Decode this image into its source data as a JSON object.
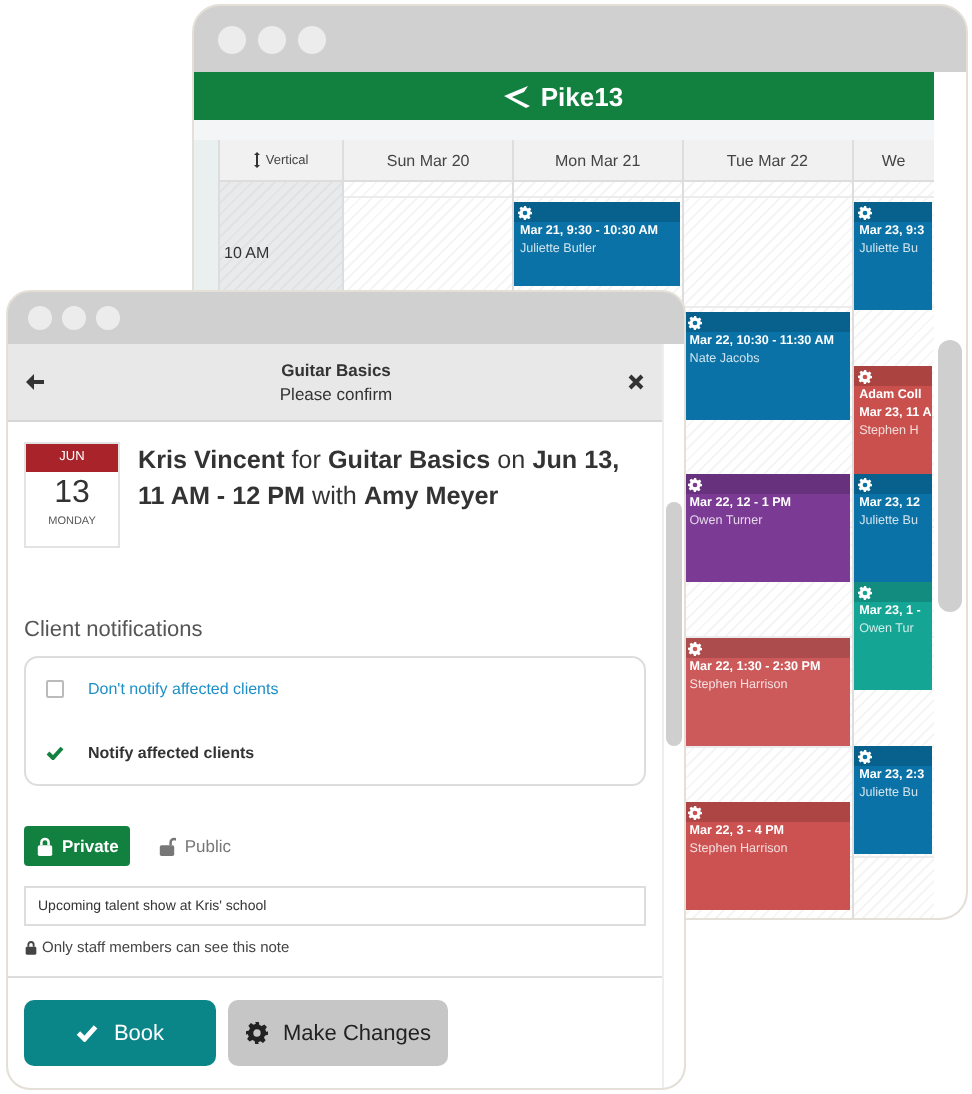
{
  "calendar_window": {
    "brand": "Pike13",
    "view_toggle": "Vertical",
    "time_labels": [
      "10 AM"
    ],
    "columns": [
      {
        "label": "Sun Mar 20"
      },
      {
        "label": "Mon Mar 21",
        "events": [
          {
            "time": "Mar 21, 9:30 - 10:30 AM",
            "client": "Juliette Butler",
            "color": "#0a72a6"
          }
        ]
      },
      {
        "label": "Tue Mar 22",
        "events": [
          {
            "time": "Mar 22, 10:30 - 11:30 AM",
            "client": "Nate Jacobs",
            "color": "#0a72a6"
          },
          {
            "time": "Mar 22, 12 - 1 PM",
            "client": "Owen Turner",
            "color": "#7b3a93"
          },
          {
            "time": "Mar 22, 1:30 - 2:30 PM",
            "client": "Stephen Harrison",
            "color": "#cc5a5a"
          },
          {
            "time": "Mar 22, 3 - 4 PM",
            "client": "Stephen Harrison",
            "color": "#cc5252"
          }
        ]
      },
      {
        "label": "We",
        "events": [
          {
            "time": "Mar 23, 9:3",
            "client": "Juliette Bu",
            "color": "#0a72a6"
          },
          {
            "title": "Adam Coll",
            "time": "Mar 23, 11 A",
            "client": "Stephen H",
            "color": "#c9504c"
          },
          {
            "time": "Mar 23, 12",
            "client": "Juliette Bu",
            "color": "#0a72a6"
          },
          {
            "time": "Mar 23, 1 -",
            "client": "Owen Tur",
            "color": "#14a594"
          },
          {
            "time": "Mar 23, 2:3",
            "client": "Juliette Bu",
            "color": "#0a72a6"
          }
        ]
      }
    ]
  },
  "booking_window": {
    "title": "Guitar Basics",
    "subtitle": "Please confirm",
    "date": {
      "month": "JUN",
      "day": "13",
      "weekday": "MONDAY"
    },
    "summary": "**Kris Vincent** for **Guitar Basics** on **Jun 13, 11 AM - 12 PM** with **Amy Meyer**",
    "notifications": {
      "heading": "Client notifications",
      "options": [
        {
          "label": "Don't notify affected clients",
          "selected": false
        },
        {
          "label": "Notify affected clients",
          "selected": true
        }
      ]
    },
    "visibility": [
      {
        "label": "Private",
        "selected": true
      },
      {
        "label": "Public",
        "selected": false
      }
    ],
    "note": {
      "value": "Upcoming talent show at Kris' school"
    },
    "note_hint": "Only staff members can see this note",
    "buttons": [
      {
        "label": "Book",
        "kind": "primary"
      },
      {
        "label": "Make Changes",
        "kind": "secondary"
      }
    ]
  }
}
